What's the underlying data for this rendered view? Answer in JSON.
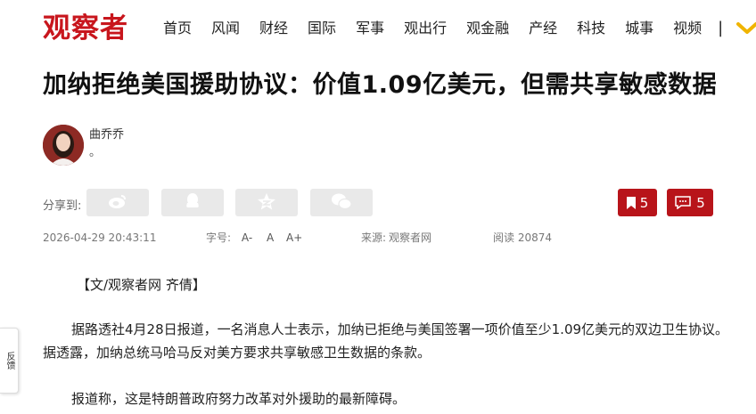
{
  "site": {
    "logo": "观察者",
    "brand_color": "#c8161d"
  },
  "nav": {
    "items": [
      "首页",
      "风闻",
      "财经",
      "国际",
      "军事",
      "观出行",
      "观金融",
      "产经",
      "科技",
      "城事",
      "视频"
    ],
    "separator": "|",
    "more_icon": "chevron-down-icon"
  },
  "article": {
    "title": "加纳拒绝美国援助协议：价值1.09亿美元，但需共享敏感数据",
    "author": {
      "name": "曲乔乔",
      "note": "。"
    },
    "share": {
      "label": "分享到:",
      "icons": [
        "weibo-icon",
        "qq-icon",
        "qzone-icon",
        "wechat-icon"
      ]
    },
    "bookmark_count": "5",
    "comment_count": "5",
    "meta": {
      "datetime": "2026-04-29 20:43:11",
      "fontsize_label": "字号:",
      "fontsize_options": [
        "A-",
        "A",
        "A+"
      ],
      "source_label": "来源:",
      "source": "观察者网",
      "reads_label": "阅读",
      "reads": "20874"
    },
    "paragraphs": [
      "【文/观察者网 齐倩】",
      "据路透社4月28日报道，一名消息人士表示，加纳已拒绝与美国签署一项价值至少1.09亿美元的双边卫生协议。据透露，加纳总统马哈马反对美方要求共享敏感卫生数据的条款。",
      "报道称，这是特朗普政府努力改革对外援助的最新障碍。"
    ]
  },
  "side_tab": {
    "label": "反馈"
  }
}
